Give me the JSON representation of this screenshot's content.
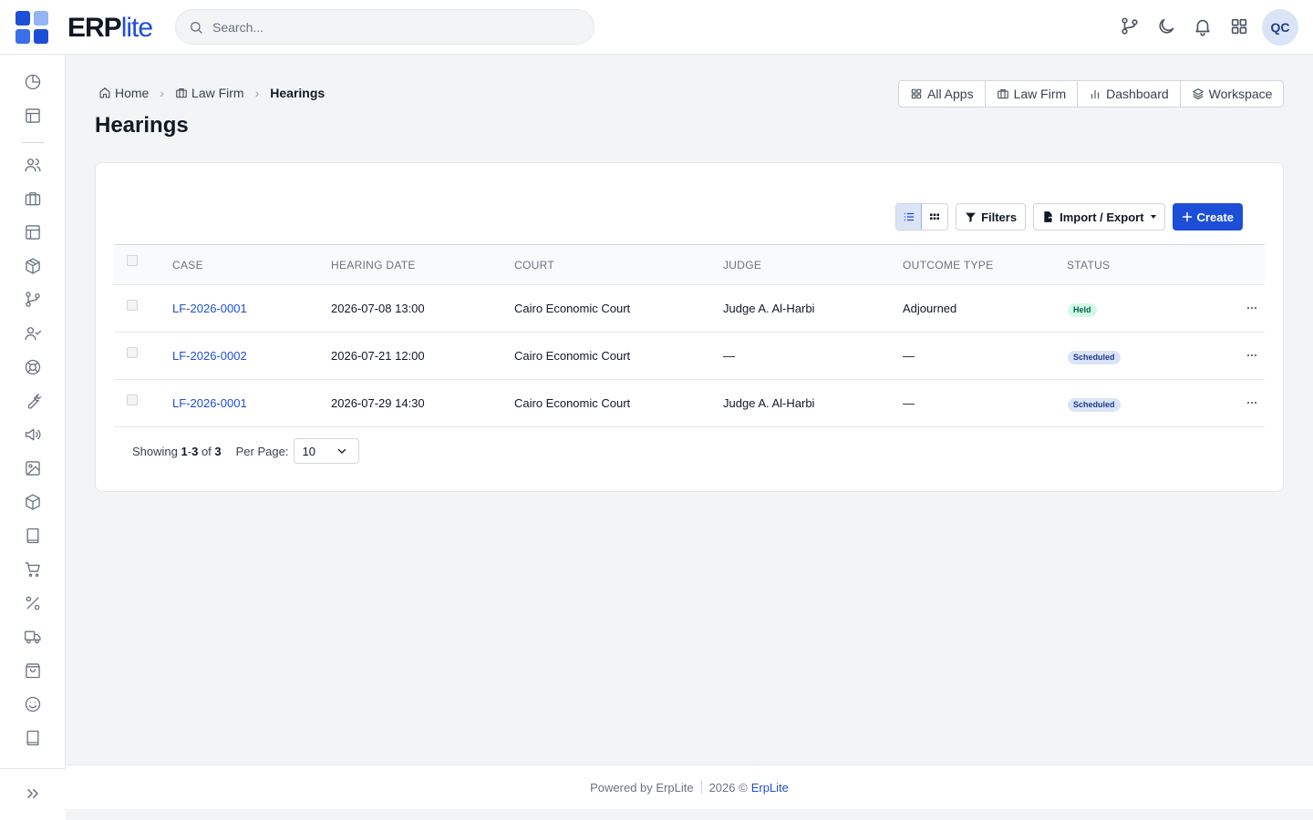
{
  "app": {
    "logo_primary": "ERP",
    "logo_secondary": "lite",
    "brand_color": "#1d4ed8"
  },
  "search": {
    "placeholder": "Search..."
  },
  "topbar": {
    "icons": [
      "git-branch-icon",
      "moon-icon",
      "bell-icon",
      "apps-grid-icon"
    ],
    "avatar_initials": "QC"
  },
  "sidebar": {
    "icons": [
      "pie-chart-icon",
      "layout-icon",
      "users-icon",
      "briefcase-icon",
      "layout-icon",
      "package-icon",
      "git-branch-icon",
      "user-check-icon",
      "lifebuoy-icon",
      "wrench-icon",
      "megaphone-icon",
      "image-icon",
      "box-icon",
      "book-icon",
      "cart-icon",
      "percent-icon",
      "truck-icon",
      "shopping-bag-icon",
      "smile-icon",
      "book-icon"
    ],
    "expand_icon": "chevrons-right-icon"
  },
  "breadcrumb": {
    "home": "Home",
    "module": "Law Firm",
    "current": "Hearings"
  },
  "page": {
    "title": "Hearings"
  },
  "quicklinks": {
    "all_apps": "All Apps",
    "module": "Law Firm",
    "dashboard": "Dashboard",
    "workspace": "Workspace"
  },
  "toolbar": {
    "filters": "Filters",
    "import_export": "Import / Export",
    "create": "Create"
  },
  "table": {
    "headers": {
      "case": "CASE",
      "hearing_date": "HEARING DATE",
      "court": "COURT",
      "judge": "JUDGE",
      "outcome_type": "OUTCOME TYPE",
      "status": "STATUS"
    },
    "rows": [
      {
        "case": "LF-2026-0001",
        "hearing_date": "2026-07-08 13:00",
        "court": "Cairo Economic Court",
        "judge": "Judge A. Al-Harbi",
        "outcome_type": "Adjourned",
        "status": "Held"
      },
      {
        "case": "LF-2026-0002",
        "hearing_date": "2026-07-21 12:00",
        "court": "Cairo Economic Court",
        "judge": "—",
        "outcome_type": "—",
        "status": "Scheduled"
      },
      {
        "case": "LF-2026-0001",
        "hearing_date": "2026-07-29 14:30",
        "court": "Cairo Economic Court",
        "judge": "Judge A. Al-Harbi",
        "outcome_type": "—",
        "status": "Scheduled"
      }
    ]
  },
  "pagination": {
    "showing_label": "Showing",
    "range_start": "1",
    "range_end": "3",
    "of_label": "of",
    "total": "3",
    "per_page_label": "Per Page:",
    "per_page_value": "10"
  },
  "footer": {
    "powered_by": "Powered by ErpLite",
    "year": "2026 ©",
    "brand": "ErpLite"
  }
}
